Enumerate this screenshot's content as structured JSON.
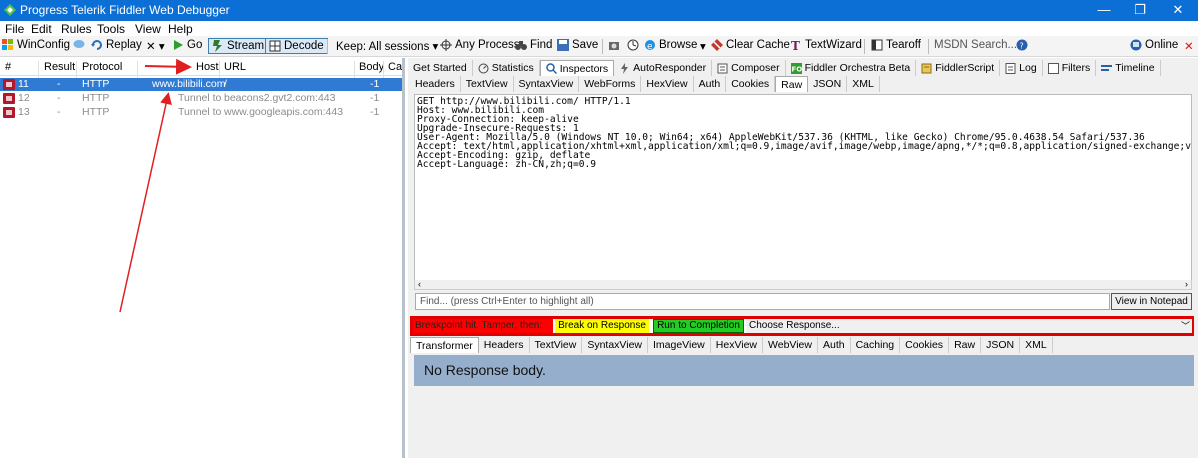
{
  "window": {
    "title": "Progress Telerik Fiddler Web Debugger",
    "controls": [
      "—",
      "❐",
      "✕"
    ]
  },
  "menu": [
    "File",
    "Edit",
    "Rules",
    "Tools",
    "View",
    "Help"
  ],
  "toolbar": {
    "winconfig": "WinConfig",
    "replay": "Replay",
    "remove": "✕ ▾",
    "go": "Go",
    "stream": "Stream",
    "decode": "Decode",
    "keep": "Keep: All sessions ▾",
    "process": "Any Process",
    "find": "Find",
    "save": "Save",
    "browse": "Browse",
    "browse_arrow": "▾",
    "clear_cache": "Clear Cache",
    "textwizard": "TextWizard",
    "tearoff": "Tearoff",
    "msdn_search": "MSDN Search...",
    "online": "Online"
  },
  "sessions": {
    "columns": [
      "#",
      "Result",
      "Protocol",
      "Host",
      "URL",
      "Body",
      "Cac"
    ],
    "rows": [
      {
        "id": "11",
        "result": "-",
        "protocol": "HTTP",
        "host": "www.bilibili.com",
        "url": "/",
        "body": "-1",
        "selected": true
      },
      {
        "id": "12",
        "result": "-",
        "protocol": "HTTP",
        "host": "Tunnel to",
        "url": "beacons2.gvt2.com:443",
        "body": "-1",
        "selected": false
      },
      {
        "id": "13",
        "result": "-",
        "protocol": "HTTP",
        "host": "Tunnel to",
        "url": "www.googleapis.com:443",
        "body": "-1",
        "selected": false
      }
    ]
  },
  "main_tabs": [
    "Get Started",
    "Statistics",
    "Inspectors",
    "AutoResponder",
    "Composer",
    "Fiddler Orchestra Beta",
    "FiddlerScript",
    "Log",
    "Filters",
    "Timeline"
  ],
  "request_tabs": [
    "Headers",
    "TextView",
    "SyntaxView",
    "WebForms",
    "HexView",
    "Auth",
    "Cookies",
    "Raw",
    "JSON",
    "XML"
  ],
  "request_raw": "GET http://www.bilibili.com/ HTTP/1.1\nHost: www.bilibili.com\nProxy-Connection: keep-alive\nUpgrade-Insecure-Requests: 1\nUser-Agent: Mozilla/5.0 (Windows NT 10.0; Win64; x64) AppleWebKit/537.36 (KHTML, like Gecko) Chrome/95.0.4638.54 Safari/537.36\nAccept: text/html,application/xhtml+xml,application/xml;q=0.9,image/avif,image/webp,image/apng,*/*;q=0.8,application/signed-exchange;v=b\nAccept-Encoding: gzip, deflate\nAccept-Language: zh-CN,zh;q=0.9",
  "find_placeholder": "Find... (press Ctrl+Enter to highlight all)",
  "view_in_notepad": "View in Notepad",
  "breakpoint": {
    "label": "Breakpoint hit. Tamper, then:",
    "break_on_response": "Break on Response",
    "run_to_completion": "Run to Completion",
    "choose_response": "Choose Response..."
  },
  "response_tabs": [
    "Transformer",
    "Headers",
    "TextView",
    "SyntaxView",
    "ImageView",
    "HexView",
    "WebView",
    "Auth",
    "Caching",
    "Cookies",
    "Raw",
    "JSON",
    "XML"
  ],
  "response_body": "No Response body.",
  "colors": {
    "titlebar": "#0b6fd6",
    "selected_row": "#2f7bd4",
    "breakpoint_red": "#ff0000",
    "break_yellow": "#ffff00",
    "run_green": "#22cc22",
    "response_body_bg": "#95aecb"
  }
}
